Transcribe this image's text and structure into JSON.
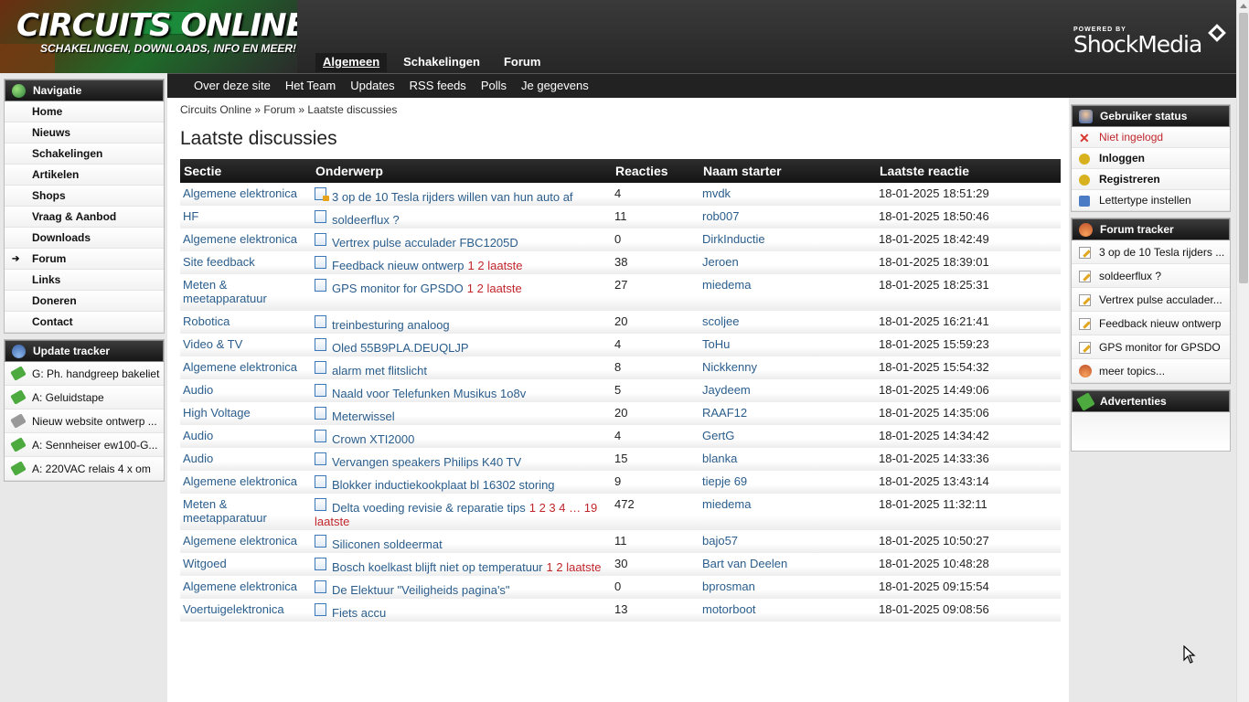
{
  "header": {
    "logo_title": "CIRCUITS ONLINE",
    "logo_tagline": "SCHAKELINGEN, DOWNLOADS, INFO EN MEER!",
    "main_nav": [
      {
        "label": "Algemeen",
        "active": true
      },
      {
        "label": "Schakelingen",
        "active": false
      },
      {
        "label": "Forum",
        "active": false
      }
    ],
    "powered_by": "POWERED BY",
    "sponsor": "ShockMedia"
  },
  "sub_nav": [
    "Over deze site",
    "Het Team",
    "Updates",
    "RSS feeds",
    "Polls",
    "Je gegevens"
  ],
  "left_sidebar": {
    "nav_title": "Navigatie",
    "nav_items": [
      {
        "label": "Home",
        "current": false
      },
      {
        "label": "Nieuws",
        "current": false
      },
      {
        "label": "Schakelingen",
        "current": false
      },
      {
        "label": "Artikelen",
        "current": false
      },
      {
        "label": "Shops",
        "current": false
      },
      {
        "label": "Vraag & Aanbod",
        "current": false
      },
      {
        "label": "Downloads",
        "current": false
      },
      {
        "label": "Forum",
        "current": true
      },
      {
        "label": "Links",
        "current": false
      },
      {
        "label": "Doneren",
        "current": false
      },
      {
        "label": "Contact",
        "current": false
      }
    ],
    "update_title": "Update tracker",
    "updates": [
      {
        "label": "G: Ph. handgreep bakeliet",
        "icon": "green-tag-icon"
      },
      {
        "label": "A: Geluidstape",
        "icon": "green-tag-icon"
      },
      {
        "label": "Nieuw website ontwerp ...",
        "icon": "grey-tag-icon"
      },
      {
        "label": "A: Sennheiser ew100-G...",
        "icon": "green-tag-icon"
      },
      {
        "label": "A: 220VAC relais 4 x om",
        "icon": "green-tag-icon"
      }
    ]
  },
  "right_sidebar": {
    "status_title": "Gebruiker status",
    "status_items": [
      {
        "label": "Niet ingelogd",
        "style": "red"
      },
      {
        "label": "Inloggen",
        "style": "bold"
      },
      {
        "label": "Registreren",
        "style": "bold"
      },
      {
        "label": "Lettertype instellen",
        "style": "normal"
      }
    ],
    "tracker_title": "Forum tracker",
    "tracker_items": [
      "3 op de 10 Tesla rijders ...",
      "soldeerflux ?",
      "Vertrex pulse acculader...",
      "Feedback nieuw ontwerp",
      "GPS monitor for GPSDO",
      "meer topics..."
    ],
    "ads_title": "Advertenties"
  },
  "main": {
    "breadcrumb": "Circuits Online » Forum » Laatste discussies",
    "title": "Laatste discussies",
    "columns": [
      "Sectie",
      "Onderwerp",
      "Reacties",
      "Naam starter",
      "Laatste reactie"
    ],
    "rows": [
      {
        "section": "Algemene elektronica",
        "topic": "3 op de 10 Tesla rijders willen van hun auto af",
        "pages": "",
        "replies": "4",
        "starter": "mvdk",
        "last": "18-01-2025 18:51:29",
        "locked": true
      },
      {
        "section": "HF",
        "topic": "soldeerflux ?",
        "pages": "",
        "replies": "11",
        "starter": "rob007",
        "last": "18-01-2025 18:50:46",
        "locked": false
      },
      {
        "section": "Algemene elektronica",
        "topic": "Vertrex pulse acculader FBC1205D",
        "pages": "",
        "replies": "0",
        "starter": "DirkInductie",
        "last": "18-01-2025 18:42:49",
        "locked": false
      },
      {
        "section": "Site feedback",
        "topic": "Feedback nieuw ontwerp",
        "pages": "1 2 laatste",
        "replies": "38",
        "starter": "Jeroen",
        "last": "18-01-2025 18:39:01",
        "locked": false
      },
      {
        "section": "Meten & meetapparatuur",
        "topic": "GPS monitor for GPSDO",
        "pages": "1 2 laatste",
        "replies": "27",
        "starter": "miedema",
        "last": "18-01-2025 18:25:31",
        "locked": false
      },
      {
        "section": "Robotica",
        "topic": "treinbesturing analoog",
        "pages": "",
        "replies": "20",
        "starter": "scoljee",
        "last": "18-01-2025 16:21:41",
        "locked": false
      },
      {
        "section": "Video & TV",
        "topic": "Oled 55B9PLA.DEUQLJP",
        "pages": "",
        "replies": "4",
        "starter": "ToHu",
        "last": "18-01-2025 15:59:23",
        "locked": false
      },
      {
        "section": "Algemene elektronica",
        "topic": "alarm met flitslicht",
        "pages": "",
        "replies": "8",
        "starter": "Nickkenny",
        "last": "18-01-2025 15:54:32",
        "locked": false
      },
      {
        "section": "Audio",
        "topic": "Naald voor Telefunken Musikus 1o8v",
        "pages": "",
        "replies": "5",
        "starter": "Jaydeem",
        "last": "18-01-2025 14:49:06",
        "locked": false
      },
      {
        "section": "High Voltage",
        "topic": "Meterwissel",
        "pages": "",
        "replies": "20",
        "starter": "RAAF12",
        "last": "18-01-2025 14:35:06",
        "locked": false
      },
      {
        "section": "Audio",
        "topic": "Crown XTI2000",
        "pages": "",
        "replies": "4",
        "starter": "GertG",
        "last": "18-01-2025 14:34:42",
        "locked": false
      },
      {
        "section": "Audio",
        "topic": "Vervangen speakers Philips K40 TV",
        "pages": "",
        "replies": "15",
        "starter": "blanka",
        "last": "18-01-2025 14:33:36",
        "locked": false
      },
      {
        "section": "Algemene elektronica",
        "topic": "Blokker inductiekookplaat bl 16302 storing",
        "pages": "",
        "replies": "9",
        "starter": "tiepje 69",
        "last": "18-01-2025 13:43:14",
        "locked": false
      },
      {
        "section": "Meten & meetapparatuur",
        "topic": "Delta voeding revisie & reparatie tips",
        "pages": "1 2 3 4 … 19 laatste",
        "replies": "472",
        "starter": "miedema",
        "last": "18-01-2025 11:32:11",
        "locked": false
      },
      {
        "section": "Algemene elektronica",
        "topic": "Siliconen soldeermat",
        "pages": "",
        "replies": "11",
        "starter": "bajo57",
        "last": "18-01-2025 10:50:27",
        "locked": false
      },
      {
        "section": "Witgoed",
        "topic": "Bosch koelkast blijft niet op temperatuur",
        "pages": "1 2 laatste",
        "replies": "30",
        "starter": "Bart van Deelen",
        "last": "18-01-2025 10:48:28",
        "locked": false
      },
      {
        "section": "Algemene elektronica",
        "topic": "De Elektuur \"Veiligheids pagina's\"",
        "pages": "",
        "replies": "0",
        "starter": "bprosman",
        "last": "18-01-2025 09:15:54",
        "locked": false
      },
      {
        "section": "Voertuigelektronica",
        "topic": "Fiets accu",
        "pages": "",
        "replies": "13",
        "starter": "motorboot",
        "last": "18-01-2025 09:08:56",
        "locked": false
      }
    ]
  }
}
